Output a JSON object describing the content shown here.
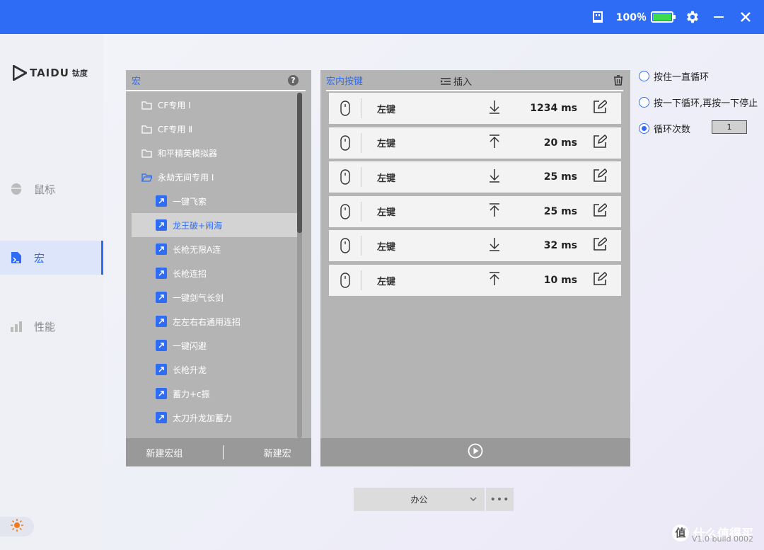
{
  "topbar": {
    "battery_percent": "100％",
    "battery_color": "#3ddc4f",
    "icons": [
      "device-icon",
      "gear-icon",
      "minimize-icon",
      "close-icon"
    ]
  },
  "brand": {
    "logo_text": "TAIDU",
    "logo_cn": "钛度"
  },
  "sidebar": {
    "items": [
      {
        "label": "鼠标",
        "icon": "mouse-icon",
        "active": false
      },
      {
        "label": "宏",
        "icon": "macro-file-icon",
        "active": true
      },
      {
        "label": "性能",
        "icon": "performance-chart-icon",
        "active": false
      }
    ],
    "theme_icon": "sun-icon"
  },
  "macro_panel": {
    "title": "宏",
    "help_label": "?",
    "groups": [
      {
        "label": "CF专用 Ⅰ"
      },
      {
        "label": "CF专用 Ⅱ"
      },
      {
        "label": "和平精英模拟器"
      },
      {
        "label": "永劫无间专用 Ⅰ"
      }
    ],
    "macros": [
      {
        "label": "一键飞索"
      },
      {
        "label": "龙王破+闹海"
      },
      {
        "label": "长枪无限A连"
      },
      {
        "label": "长枪连招"
      },
      {
        "label": "一键剑气长剑"
      },
      {
        "label": "左左右右通用连招"
      },
      {
        "label": "一键闪避"
      },
      {
        "label": "长枪升龙"
      },
      {
        "label": "蓄力+c振"
      },
      {
        "label": "太刀升龙加蓄力"
      }
    ],
    "selected_index": 1,
    "footer": {
      "new_group": "新建宏组",
      "new_macro": "新建宏"
    }
  },
  "keys_panel": {
    "title": "宏内按键",
    "insert_label": "插入",
    "rows": [
      {
        "key": "左键",
        "direction": "down",
        "delay": "1234 ms"
      },
      {
        "key": "左键",
        "direction": "up",
        "delay": "20 ms"
      },
      {
        "key": "左键",
        "direction": "down",
        "delay": "25 ms"
      },
      {
        "key": "左键",
        "direction": "up",
        "delay": "25 ms"
      },
      {
        "key": "左键",
        "direction": "down",
        "delay": "32 ms"
      },
      {
        "key": "左键",
        "direction": "up",
        "delay": "10 ms"
      }
    ]
  },
  "loop_options": {
    "opt1": "按住一直循环",
    "opt2": "按一下循环,再按一下停止",
    "opt3": "循环次数",
    "selected": 3,
    "count": "1"
  },
  "profile": {
    "current": "办公",
    "more_label": "•••"
  },
  "watermark": {
    "logo": "值",
    "text": "什么值得买",
    "build": "V1.0 build 0002"
  },
  "colors": {
    "accent": "#2e6cf6",
    "panel": "#b4b4b4"
  }
}
